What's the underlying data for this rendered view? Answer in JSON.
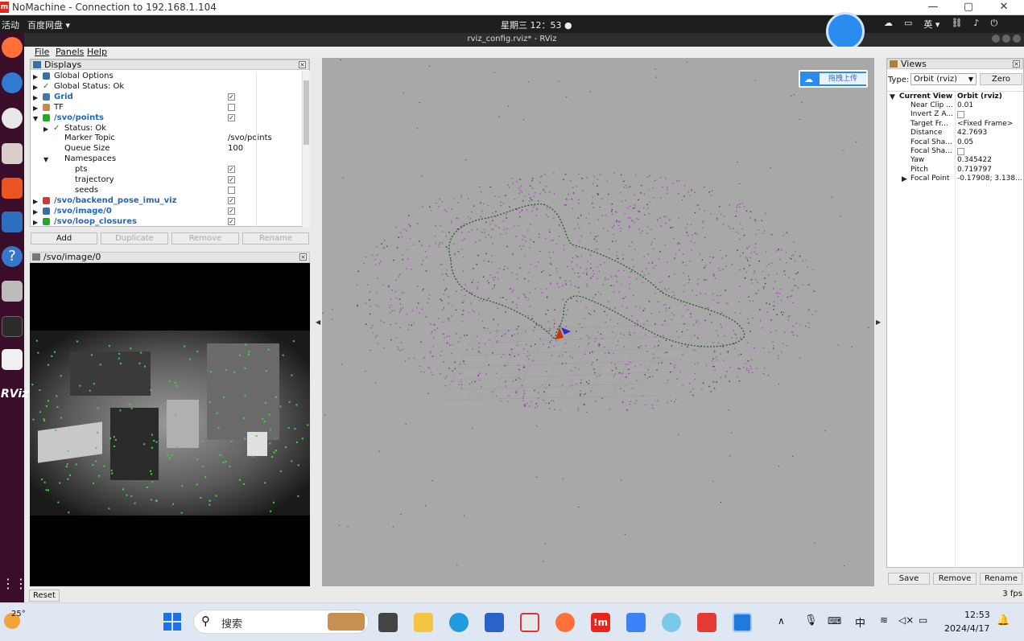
{
  "nomachine": {
    "title": "NoMachine - Connection to 192.168.1.104",
    "logo": "m",
    "controls": {
      "min": "—",
      "max": "▢",
      "close": "✕"
    }
  },
  "ubuntu": {
    "activities": "活动",
    "app_menu": "百度网盘 ▾",
    "clock": "星期三 12：53 ●",
    "input_method": "英 ▾",
    "tray_icons": [
      "cloud-icon",
      "window-icon",
      "network-icon",
      "volume-icon",
      "power-icon"
    ]
  },
  "rviz": {
    "window_title": "rviz_config.rviz* - RViz",
    "menu": {
      "file": "File",
      "panels": "Panels",
      "help": "Help"
    },
    "displays": {
      "title": "Displays",
      "rows": [
        {
          "label": "Global Options",
          "value": ""
        },
        {
          "label": "Global Status: Ok",
          "value": ""
        },
        {
          "label": "Grid",
          "value": "✓"
        },
        {
          "label": "TF",
          "value": ""
        },
        {
          "label": "/svo/points",
          "value": "✓"
        },
        {
          "label": "Status: Ok",
          "value": ""
        },
        {
          "label": "Marker Topic",
          "value": "/svo/points"
        },
        {
          "label": "Queue Size",
          "value": "100"
        },
        {
          "label": "Namespaces",
          "value": ""
        },
        {
          "label": "pts",
          "value": "✓"
        },
        {
          "label": "trajectory",
          "value": "✓"
        },
        {
          "label": "seeds",
          "value": ""
        },
        {
          "label": "/svo/backend_pose_imu_viz",
          "value": "✓"
        },
        {
          "label": "/svo/image/0",
          "value": "✓"
        },
        {
          "label": "/svo/loop_closures",
          "value": "✓"
        }
      ],
      "buttons": {
        "add": "Add",
        "duplicate": "Duplicate",
        "remove": "Remove",
        "rename": "Rename"
      }
    },
    "image_panel": {
      "title": "/svo/image/0"
    },
    "upload_badge": "拖拽上传",
    "views": {
      "title": "Views",
      "type_label": "Type:",
      "type_value": "Orbit (rviz)",
      "zero": "Zero",
      "current_view": "Current View",
      "current_view_type": "Orbit (rviz)",
      "props": [
        {
          "k": "Near Clip ...",
          "v": "0.01"
        },
        {
          "k": "Invert Z A...",
          "v": ""
        },
        {
          "k": "Target Fr...",
          "v": "<Fixed Frame>"
        },
        {
          "k": "Distance",
          "v": "42.7693"
        },
        {
          "k": "Focal Sha...",
          "v": "0.05"
        },
        {
          "k": "Focal Sha...",
          "v": ""
        },
        {
          "k": "Yaw",
          "v": "0.345422"
        },
        {
          "k": "Pitch",
          "v": "0.719797"
        },
        {
          "k": "Focal Point",
          "v": "-0.17908; 3.138..."
        }
      ],
      "buttons": {
        "save": "Save",
        "remove": "Remove",
        "rename": "Rename"
      }
    },
    "reset": "Reset",
    "fps": "3 fps",
    "dock_label": "RViz"
  },
  "taskbar": {
    "weather": "25°",
    "search_placeholder": "搜索",
    "ime": "中",
    "time": "12:53",
    "date": "2024/4/17"
  }
}
